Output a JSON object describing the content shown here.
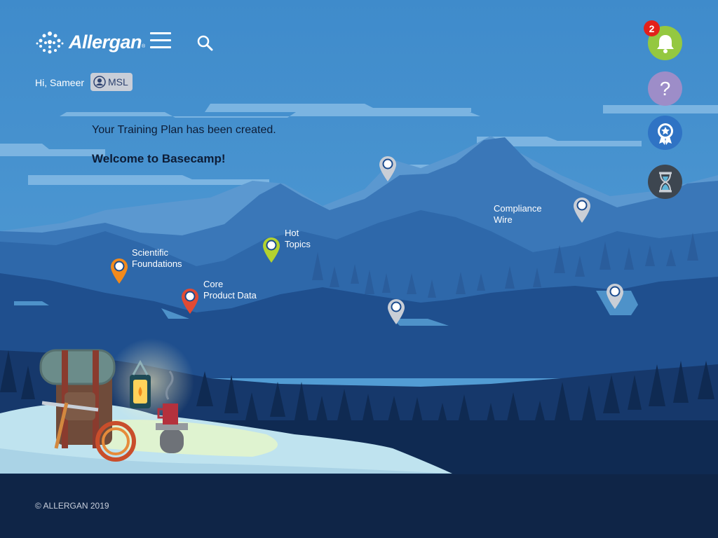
{
  "header": {
    "brand": "Allergan",
    "tm": "®",
    "menu_icon": "hamburger-menu-icon",
    "search_icon": "search-icon"
  },
  "user": {
    "greeting": "Hi, Sameer",
    "role": "MSL"
  },
  "messages": {
    "plan_created": "Your Training Plan has been created.",
    "welcome": "Welcome to Basecamp!"
  },
  "right_buttons": {
    "notifications": {
      "icon": "bell-icon",
      "count": "2",
      "color": "#94c840"
    },
    "help": {
      "icon": "question-icon",
      "label": "?",
      "color": "#9d8dc8"
    },
    "achievements": {
      "icon": "award-badge-icon",
      "color": "#2f73c4"
    },
    "timer": {
      "icon": "hourglass-icon",
      "color": "#3d4650"
    }
  },
  "map_points": [
    {
      "id": "scientific-foundations",
      "line1": "Scientific",
      "line2": "Foundations",
      "color": "#f28a1c"
    },
    {
      "id": "core-product-data",
      "line1": "Core",
      "line2": "Product Data",
      "color": "#e24a33"
    },
    {
      "id": "hot-topics",
      "line1": "Hot",
      "line2": "Topics",
      "color": "#b3d22f"
    },
    {
      "id": "compliance-wire",
      "line1": "Compliance",
      "line2": "Wire",
      "color": "#94c840",
      "icon": "flashlight-icon"
    },
    {
      "id": "locked-1",
      "color": "#c9ced6"
    },
    {
      "id": "locked-2",
      "color": "#c9ced6"
    },
    {
      "id": "locked-3",
      "color": "#c9ced6"
    },
    {
      "id": "locked-4",
      "color": "#c9ced6"
    }
  ],
  "footer": {
    "copyright": "© ALLERGAN 2019"
  },
  "colors": {
    "sky": "#4a93cf",
    "footer": "#0f2547",
    "accent_green": "#94c840"
  }
}
